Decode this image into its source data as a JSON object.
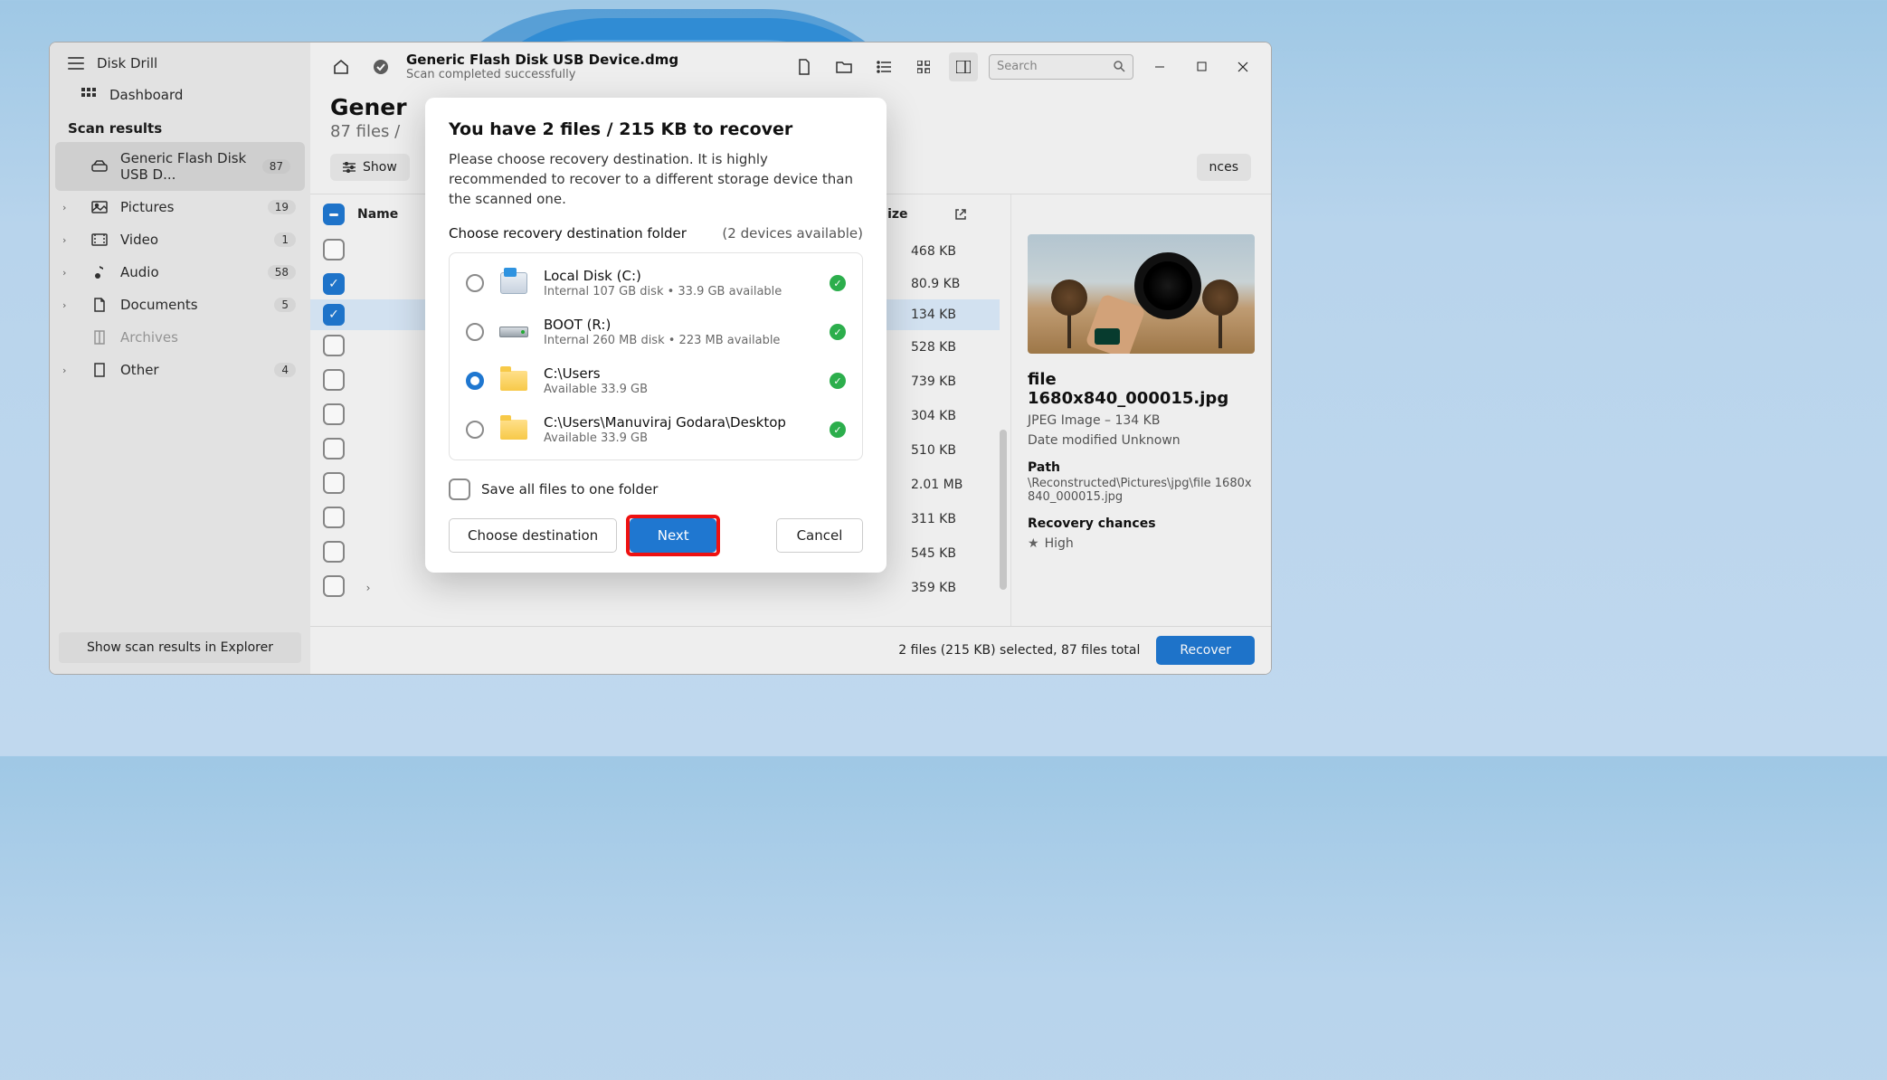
{
  "app": {
    "name": "Disk Drill"
  },
  "sidebar": {
    "dashboard": "Dashboard",
    "results_header": "Scan results",
    "disk_item": {
      "label": "Generic Flash Disk USB D...",
      "count": "87"
    },
    "categories": [
      {
        "label": "Pictures",
        "count": "19"
      },
      {
        "label": "Video",
        "count": "1"
      },
      {
        "label": "Audio",
        "count": "58"
      },
      {
        "label": "Documents",
        "count": "5"
      },
      {
        "label": "Archives",
        "count": ""
      },
      {
        "label": "Other",
        "count": "4"
      }
    ],
    "explorer_button": "Show scan results in Explorer"
  },
  "toolbar": {
    "title": "Generic Flash Disk USB Device.dmg",
    "subtitle": "Scan completed successfully",
    "search_placeholder": "Search"
  },
  "header": {
    "title_truncated": "Gener",
    "subtitle_truncated": "87 files /"
  },
  "filters": {
    "show": "Show",
    "chances_suffix": "nces"
  },
  "table": {
    "name_header": "Name",
    "size_header": "Size",
    "rows": [
      {
        "checked": false,
        "size": "468 KB"
      },
      {
        "checked": true,
        "size": "80.9 KB"
      },
      {
        "checked": true,
        "size": "134 KB",
        "selected": true
      },
      {
        "checked": false,
        "size": "528 KB"
      },
      {
        "checked": false,
        "size": "739 KB"
      },
      {
        "checked": false,
        "size": "304 KB"
      },
      {
        "checked": false,
        "size": "510 KB"
      },
      {
        "checked": false,
        "size": "2.01 MB"
      },
      {
        "checked": false,
        "size": "311 KB"
      },
      {
        "checked": false,
        "size": "545 KB"
      },
      {
        "checked": false,
        "size": "359 KB",
        "expandable": true
      }
    ]
  },
  "details": {
    "filename": "file 1680x840_000015.jpg",
    "type_line": "JPEG Image – 134 KB",
    "modified_line": "Date modified Unknown",
    "path_label": "Path",
    "path_value": "\\Reconstructed\\Pictures\\jpg\\file 1680x840_000015.jpg",
    "recovery_label": "Recovery chances",
    "recovery_value": "High"
  },
  "footer": {
    "status": "2 files (215 KB) selected, 87 files total",
    "recover": "Recover"
  },
  "modal": {
    "title": "You have 2 files / 215 KB to recover",
    "desc": "Please choose recovery destination. It is highly recommended to recover to a different storage device than the scanned one.",
    "choose_label": "Choose recovery destination folder",
    "devices_label": "(2 devices available)",
    "destinations": [
      {
        "name": "Local Disk (C:)",
        "sub": "Internal 107 GB disk • 33.9 GB available",
        "icon": "drive-c",
        "selected": false
      },
      {
        "name": "BOOT (R:)",
        "sub": "Internal 260 MB disk • 223 MB available",
        "icon": "drive-r",
        "selected": false
      },
      {
        "name": "C:\\Users",
        "sub": "Available 33.9 GB",
        "icon": "folder",
        "selected": true
      },
      {
        "name": "C:\\Users\\Manuviraj Godara\\Desktop",
        "sub": "Available 33.9 GB",
        "icon": "folder",
        "selected": false
      }
    ],
    "save_one_folder": "Save all files to one folder",
    "choose_btn": "Choose destination",
    "next_btn": "Next",
    "cancel_btn": "Cancel"
  }
}
